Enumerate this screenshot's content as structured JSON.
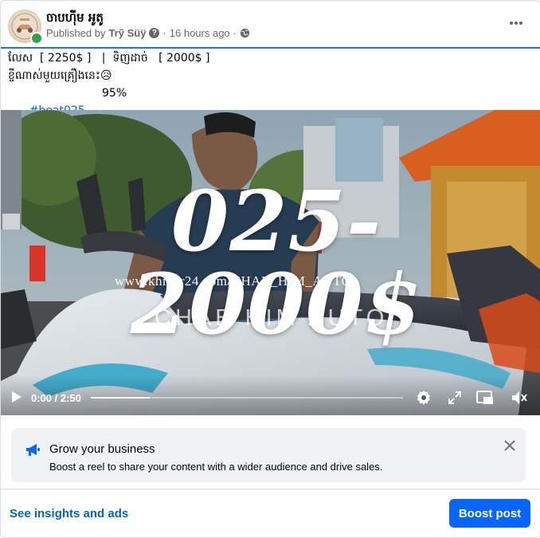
{
  "post": {
    "page_name": "ចាបហ៊ីម អូតូ",
    "published_prefix": "Published by",
    "author": "Trỹ Süÿ",
    "separator": "·",
    "time_ago": "16 hours ago",
    "icons": {
      "info": "question-icon",
      "audience": "globe-icon",
      "menu": "more-icon"
    }
  },
  "caption": {
    "line1": "លែស  [ 2250$ ]   |  ទិញដាច់   [ 2000$ ]",
    "line2": "ខ្ចីណាស់មួយគ្រឿងនេះ",
    "emoji": "😥",
    "hashtag": "#beat025",
    "condition": "95%"
  },
  "video": {
    "overlay_title": "025-2000$",
    "watermark_url": "www.khmer24.com/CHAB_HIM_AUTO",
    "brand_text": "CHAB HIM AUTO",
    "current_time": "0:00",
    "duration": "2:50",
    "time_separator": " / ",
    "progress_fraction": 0.19,
    "icons": [
      "play-icon",
      "gear-icon",
      "expand-icon",
      "pip-icon",
      "mute-icon"
    ]
  },
  "promo": {
    "title": "Grow your business",
    "subtitle": "Boost a reel to share your content with a wider audience and drive sales.",
    "icon": "megaphone-icon"
  },
  "footer": {
    "insights_label": "See insights and ads",
    "boost_label": "Boost post"
  },
  "colors": {
    "accent": "#1877f2",
    "link": "#0064d1",
    "button": "#0866ff",
    "online": "#31a24c"
  }
}
